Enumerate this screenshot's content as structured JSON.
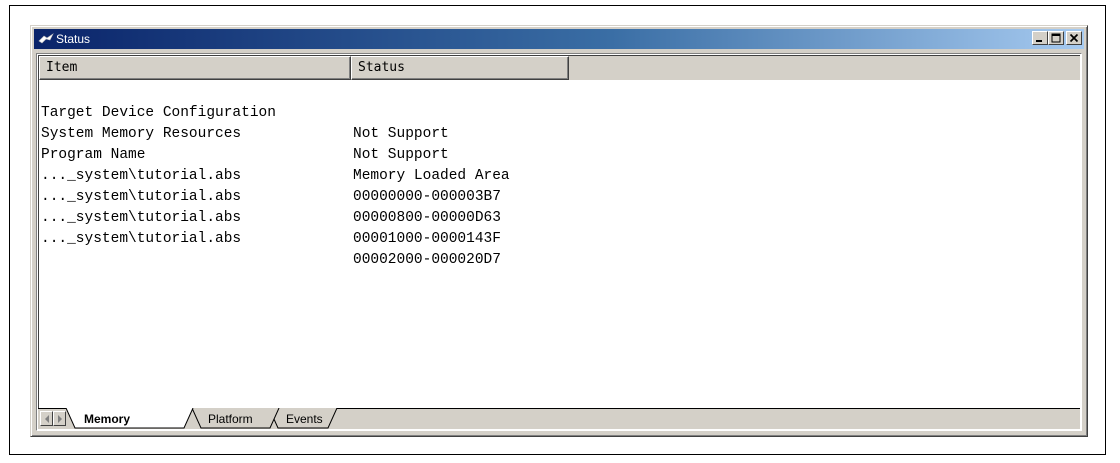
{
  "window": {
    "title": "Status",
    "controls": {
      "minimize": "_",
      "maximize": "□",
      "close": "×"
    }
  },
  "list": {
    "columns": [
      "Item",
      "Status"
    ],
    "rows": [
      {
        "item": "Target Device Configuration",
        "status": "Not Support"
      },
      {
        "item": "System Memory Resources",
        "status": "Not Support"
      },
      {
        "item": "Program Name",
        "status": "Memory Loaded Area"
      },
      {
        "item": "..._system\\tutorial.abs",
        "status": "00000000-000003B7"
      },
      {
        "item": "..._system\\tutorial.abs",
        "status": "00000800-00000D63"
      },
      {
        "item": "..._system\\tutorial.abs",
        "status": "00001000-0000143F"
      },
      {
        "item": "..._system\\tutorial.abs",
        "status": "00002000-000020D7"
      }
    ]
  },
  "tabs": [
    {
      "label": "Memory",
      "active": true
    },
    {
      "label": "Platform",
      "active": false
    },
    {
      "label": "Events",
      "active": false
    }
  ],
  "colors": {
    "titlebar_start": "#0a246a",
    "titlebar_end": "#a6caf0",
    "face": "#d4d0c8"
  }
}
